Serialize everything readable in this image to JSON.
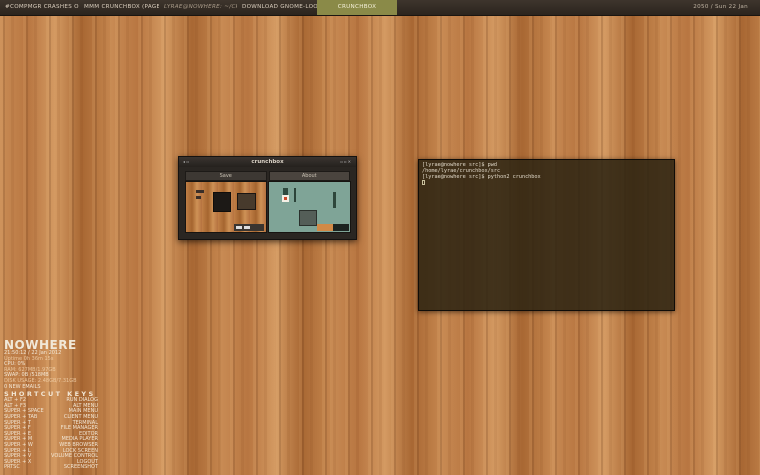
{
  "panel": {
    "tasks": [
      "#Compmgr crashes on fl",
      "mmm crunchbox (page 8",
      "lyrae@nowhere: ~/crunc",
      "Download gnome-looko",
      "Crunchbox"
    ],
    "active_task_index": 4,
    "clock": "2050 / Sun 22 Jan"
  },
  "crunchbox_window": {
    "title": "crunchbox",
    "tabs": [
      "Save",
      "About"
    ]
  },
  "terminal": {
    "lines": [
      "[lyrae@nowhere src]$ pwd",
      "/home/lyrae/crunchbox/src",
      "[lyrae@nowhere src]$ python2 crunchbox"
    ]
  },
  "conky": {
    "hostname": "NOWHERE",
    "datetime": "21:50:12 / 22 Jan 2012",
    "uptime": "Uptime 0h 36m 15s",
    "cpu": "CPU: 0%",
    "ram": "RAM: 627MB/1.97GB",
    "swap": "SWAP: 0B /518MB",
    "disk": "DISK USAGE: 2.48GB/7.31GB",
    "emails": "0 NEW EMAILS",
    "shortcuts_heading": "SHORTCUT KEYS",
    "shortcuts": [
      {
        "key": "Alt + F2",
        "action": "Run Dialog"
      },
      {
        "key": "Alt + F3",
        "action": "Alt Menu"
      },
      {
        "key": "Super + Space",
        "action": "Main Menu"
      },
      {
        "key": "Super + Tab",
        "action": "Client Menu"
      },
      {
        "key": "Super + t",
        "action": "Terminal"
      },
      {
        "key": "Super + f",
        "action": "File Manager"
      },
      {
        "key": "Super + e",
        "action": "Editor"
      },
      {
        "key": "Super + m",
        "action": "Media Player"
      },
      {
        "key": "Super + w",
        "action": "Web Browser"
      },
      {
        "key": "Super + l",
        "action": "Lock Screen"
      },
      {
        "key": "Super + v",
        "action": "Volume Control"
      },
      {
        "key": "Super + x",
        "action": "Logout"
      },
      {
        "key": "PrtSc",
        "action": "Screenshot"
      }
    ]
  }
}
